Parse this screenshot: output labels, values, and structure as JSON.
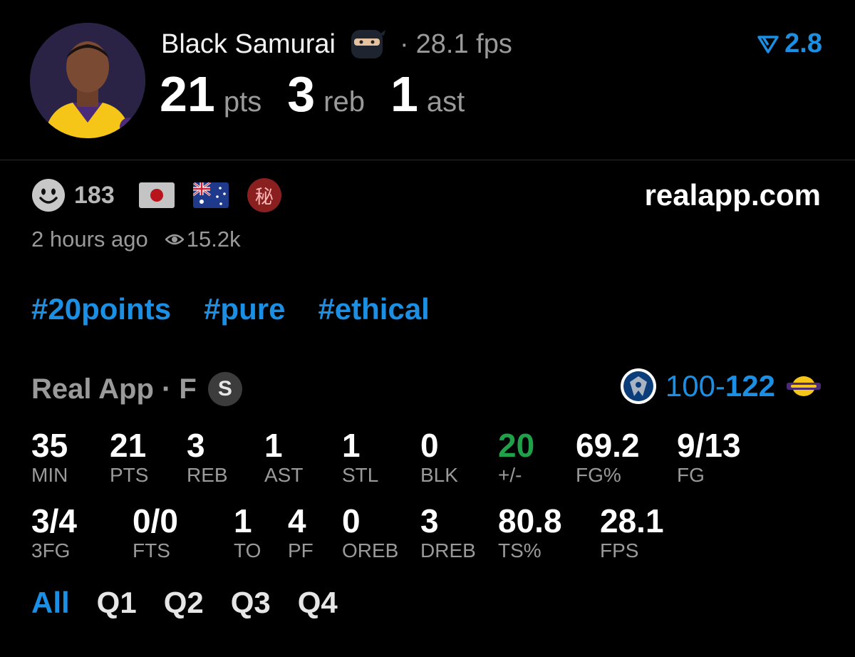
{
  "player": {
    "name": "Black Samurai",
    "fps": "28.1 fps",
    "rank": "2.8",
    "pts": "21",
    "pts_unit": "pts",
    "reb": "3",
    "reb_unit": "reb",
    "ast": "1",
    "ast_unit": "ast"
  },
  "meta": {
    "reactions": "183",
    "time_ago": "2 hours ago",
    "views": "15.2k",
    "site": "realapp.com",
    "hidden_badge": "秘"
  },
  "tags": [
    "#20points",
    "#pure",
    "#ethical"
  ],
  "game": {
    "label": "Real App · F",
    "season_badge": "S",
    "score_left": "100-",
    "score_right": "122"
  },
  "box_score": {
    "row1": [
      {
        "value": "35",
        "label": "MIN"
      },
      {
        "value": "21",
        "label": "PTS"
      },
      {
        "value": "3",
        "label": "REB"
      },
      {
        "value": "1",
        "label": "AST"
      },
      {
        "value": "1",
        "label": "STL"
      },
      {
        "value": "0",
        "label": "BLK"
      },
      {
        "value": "20",
        "label": "+/-"
      },
      {
        "value": "69.2",
        "label": "FG%"
      },
      {
        "value": "9/13",
        "label": "FG"
      }
    ],
    "row2": [
      {
        "value": "3/4",
        "label": "3FG"
      },
      {
        "value": "0/0",
        "label": "FTS"
      },
      {
        "value": "1",
        "label": "TO"
      },
      {
        "value": "4",
        "label": "PF"
      },
      {
        "value": "0",
        "label": "OREB"
      },
      {
        "value": "3",
        "label": "DREB"
      },
      {
        "value": "80.8",
        "label": "TS%"
      },
      {
        "value": "28.1",
        "label": "FPS"
      }
    ]
  },
  "quarters": [
    "All",
    "Q1",
    "Q2",
    "Q3",
    "Q4"
  ],
  "colors": {
    "accent": "#1a8fe3",
    "positive": "#1fa14a",
    "muted": "#9a9a9a",
    "background": "#000000"
  },
  "icons": {
    "avatar": "player-avatar",
    "emoji": "ninja-icon",
    "rank": "rank-arrow-icon",
    "reactions": "smiley-icon",
    "flags": [
      "japan-flag-icon",
      "australia-flag-icon"
    ],
    "views": "eye-icon",
    "teams": [
      "mavericks-logo",
      "lakers-logo"
    ]
  }
}
